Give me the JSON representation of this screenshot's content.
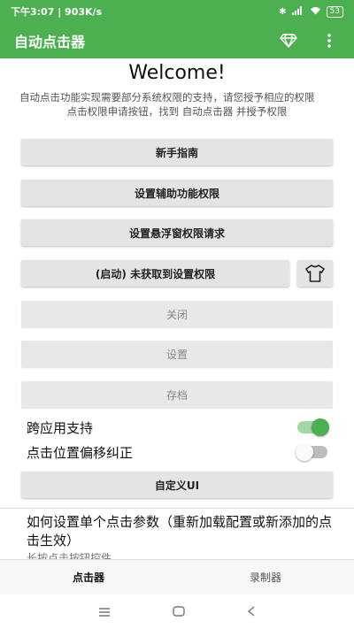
{
  "status_bar": {
    "time_speed": "下午3:07 | 903K/s",
    "battery": "53"
  },
  "app_bar": {
    "title": "自动点击器"
  },
  "main": {
    "welcome": "Welcome!",
    "description": "自动点击功能实现需要部分系统权限的支持，请您授予相应的权限",
    "instruction": "点击权限申请按钮，找到 自动点击器 并授予权限",
    "buttons": {
      "guide": "新手指南",
      "accessibility": "设置辅助功能权限",
      "overlay": "设置悬浮窗权限请求",
      "start": "(启动) 未获取到设置权限",
      "close": "关闭",
      "settings": "设置",
      "archive": "存档",
      "custom_ui": "自定义UI"
    },
    "toggles": {
      "cross_app": {
        "label": "跨应用支持",
        "on": true
      },
      "offset": {
        "label": "点击位置偏移纠正",
        "on": false
      }
    },
    "section": {
      "title": "如何设置单个点击参数（重新加载配置或新添加的点击生效）",
      "subtitle": "长按点击按钮控件"
    }
  },
  "bottom_nav": {
    "tabs": [
      "点击器",
      "录制器"
    ],
    "active": 0
  },
  "colors": {
    "primary": "#4caf50",
    "button_bg": "#e4e4e4"
  }
}
